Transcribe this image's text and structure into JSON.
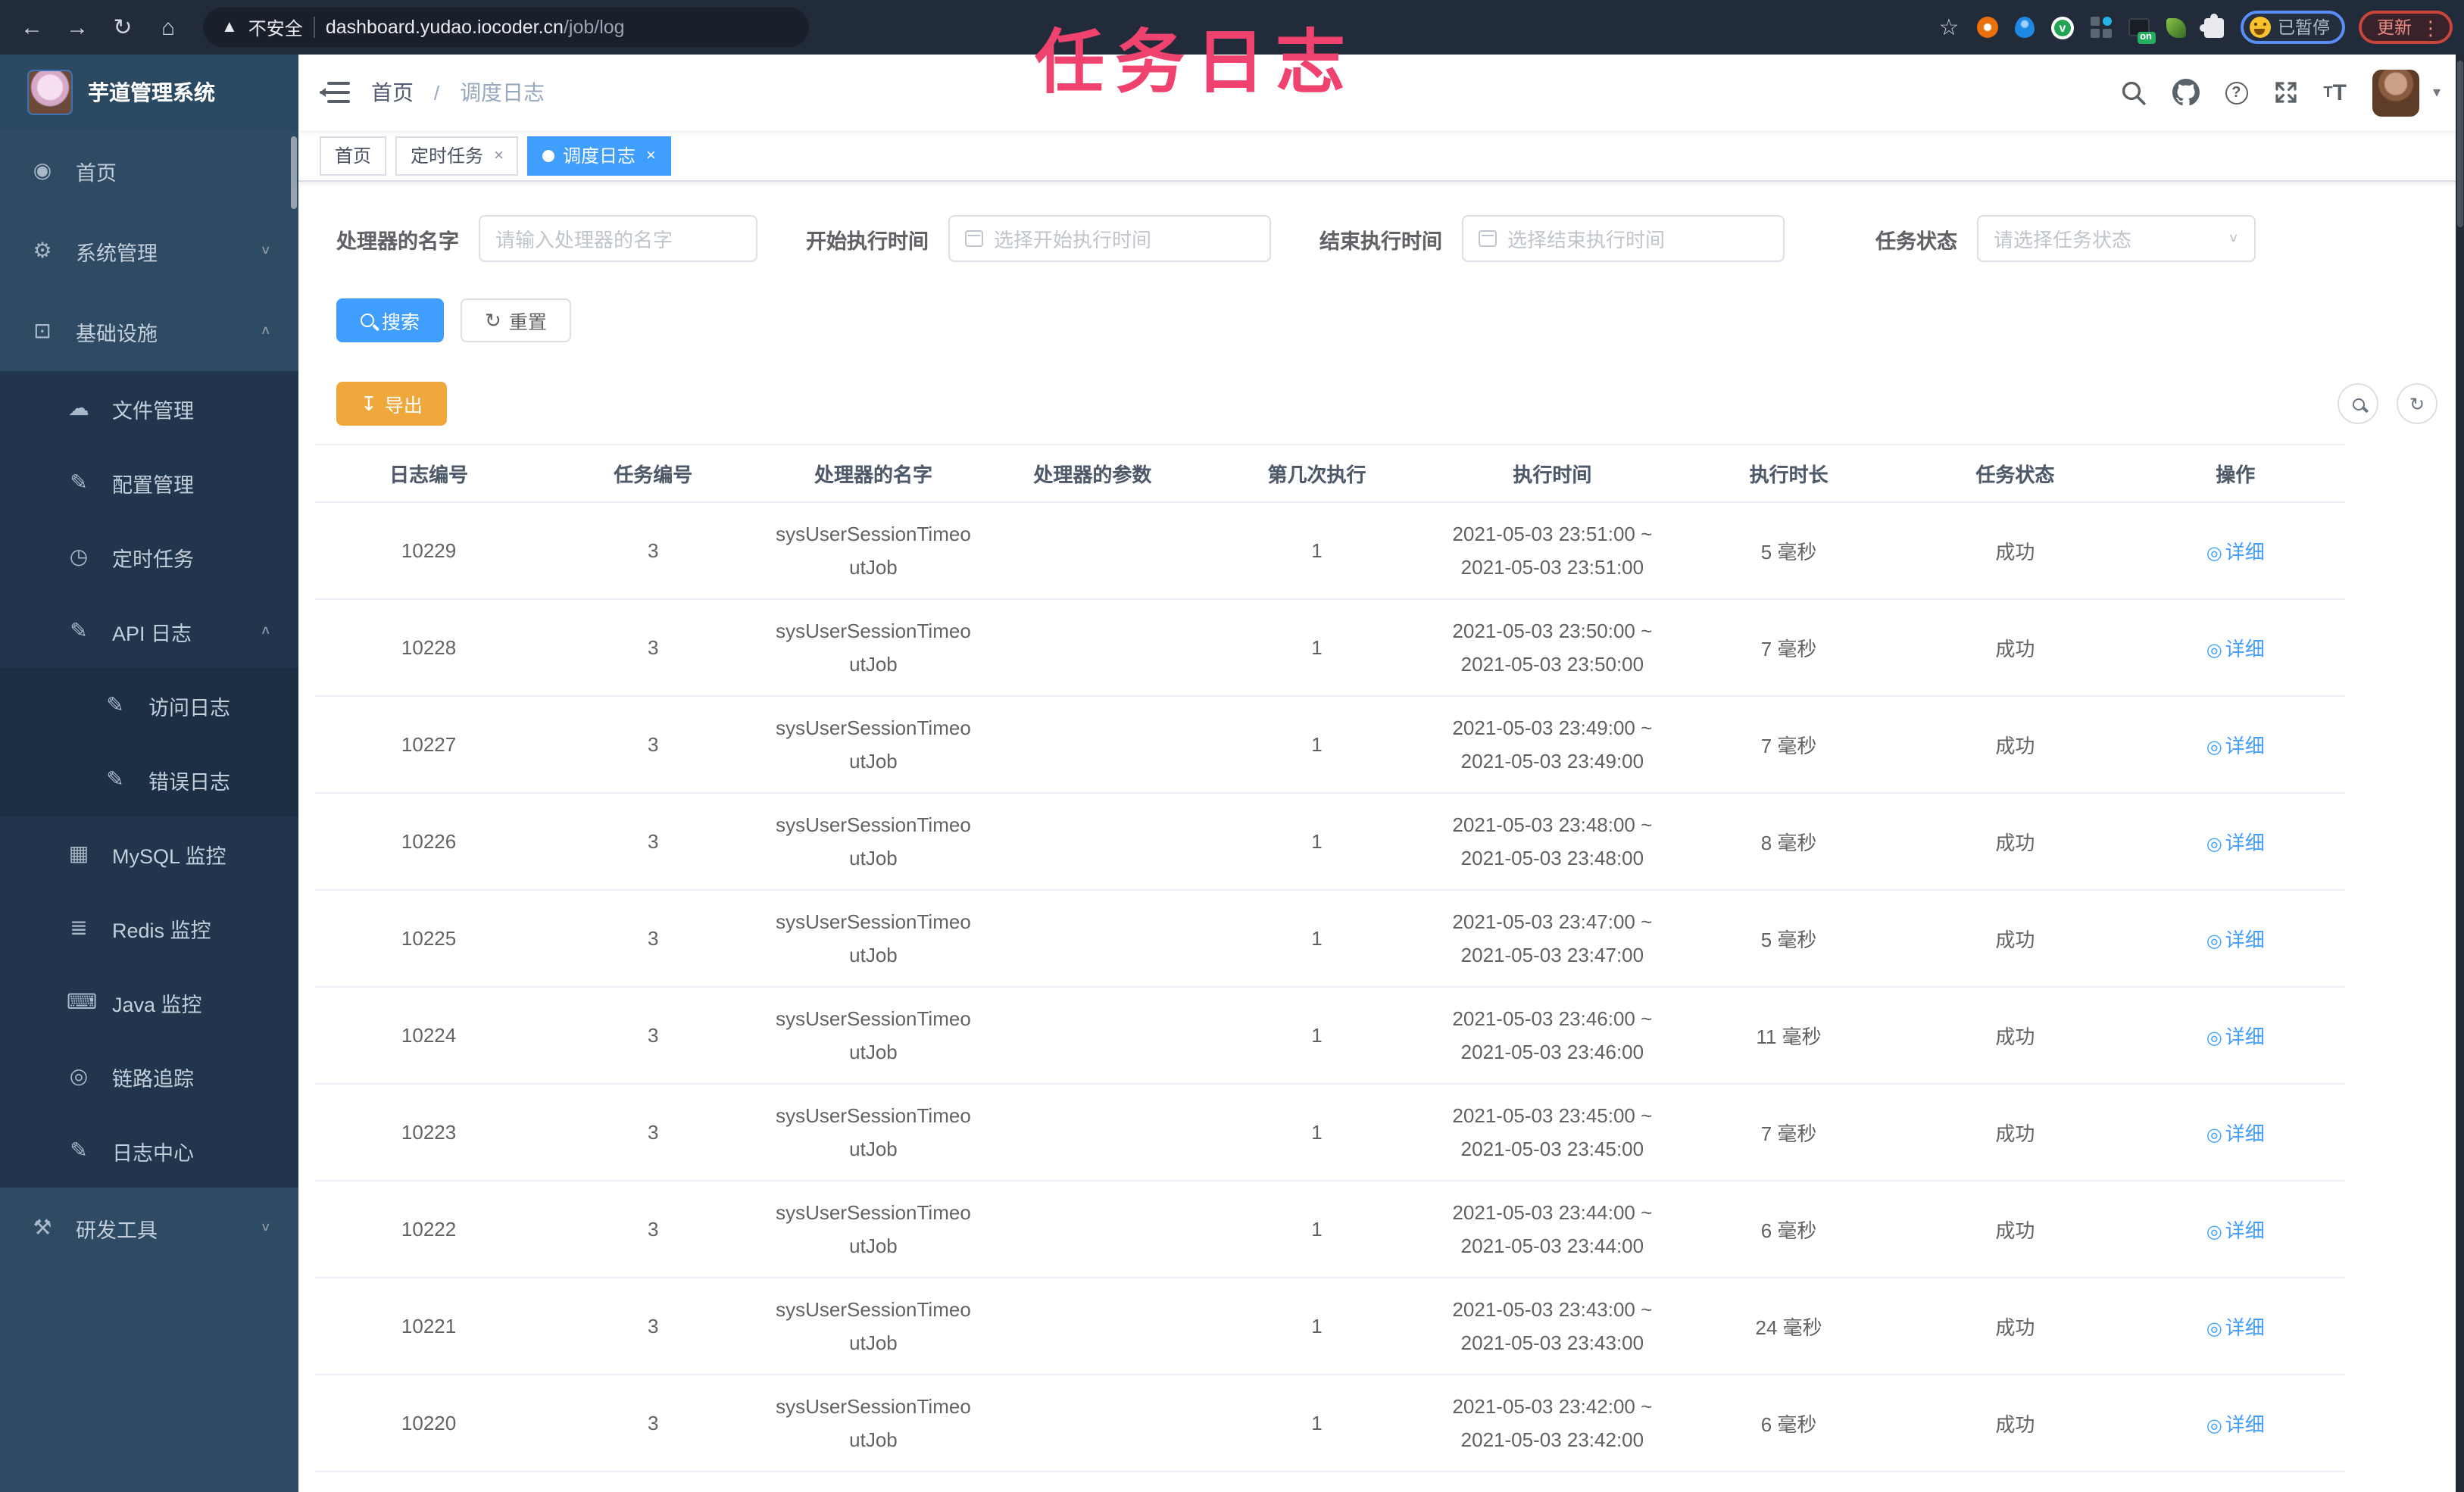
{
  "colors": {
    "accent": "#409eff",
    "warning": "#f0a73c",
    "overlay_pink": "#f0426e",
    "sidebar_bg": "#2e4b63",
    "sidebar_sub_bg": "#21354c"
  },
  "browser": {
    "security_label": "不安全",
    "url_host": "dashboard.yudao.iocoder.cn",
    "url_path": "/job/log",
    "extension_on_label": "on",
    "paused_badge": "已暂停",
    "update_label": "更新"
  },
  "overlay": {
    "title": "任务日志"
  },
  "sidebar": {
    "logo_title": "芋道管理系统",
    "items": [
      {
        "key": "home",
        "label": "首页",
        "icon": "dashboard-icon",
        "level": 1,
        "chevron": null
      },
      {
        "key": "system-mgmt",
        "label": "系统管理",
        "icon": "gear-icon",
        "level": 1,
        "chevron": "down"
      },
      {
        "key": "infrastructure",
        "label": "基础设施",
        "icon": "monitor-icon",
        "level": 1,
        "chevron": "up"
      },
      {
        "key": "file-mgmt",
        "label": "文件管理",
        "icon": "cloud-upload-icon",
        "level": 2,
        "chevron": null
      },
      {
        "key": "config-mgmt",
        "label": "配置管理",
        "icon": "edit-icon",
        "level": 2,
        "chevron": null
      },
      {
        "key": "scheduled-tasks",
        "label": "定时任务",
        "icon": "timer-icon",
        "level": 2,
        "chevron": null
      },
      {
        "key": "api-log",
        "label": "API 日志",
        "icon": "log-icon",
        "level": 2,
        "chevron": "up"
      },
      {
        "key": "access-log",
        "label": "访问日志",
        "icon": "log-icon",
        "level": 3,
        "chevron": null
      },
      {
        "key": "error-log",
        "label": "错误日志",
        "icon": "log-icon",
        "level": 3,
        "chevron": null
      },
      {
        "key": "mysql-monitor",
        "label": "MySQL 监控",
        "icon": "table-icon",
        "level": 2,
        "chevron": null
      },
      {
        "key": "redis-monitor",
        "label": "Redis 监控",
        "icon": "layers-icon",
        "level": 2,
        "chevron": null
      },
      {
        "key": "java-monitor",
        "label": "Java 监控",
        "icon": "java-icon",
        "level": 2,
        "chevron": null
      },
      {
        "key": "trace",
        "label": "链路追踪",
        "icon": "eye-icon",
        "level": 2,
        "chevron": null
      },
      {
        "key": "log-center",
        "label": "日志中心",
        "icon": "log-icon",
        "level": 2,
        "chevron": null
      },
      {
        "key": "dev-tools",
        "label": "研发工具",
        "icon": "toolbox-icon",
        "level": 1,
        "chevron": "down"
      }
    ]
  },
  "header": {
    "breadcrumb": [
      "首页",
      "调度日志"
    ]
  },
  "tags": [
    {
      "label": "首页",
      "closable": false,
      "active": false
    },
    {
      "label": "定时任务",
      "closable": true,
      "active": false
    },
    {
      "label": "调度日志",
      "closable": true,
      "active": true
    }
  ],
  "filters": [
    {
      "key": "handler-name",
      "label": "处理器的名字",
      "placeholder": "请输入处理器的名字",
      "type": "text"
    },
    {
      "key": "start-time",
      "label": "开始执行时间",
      "placeholder": "选择开始执行时间",
      "type": "date"
    },
    {
      "key": "end-time",
      "label": "结束执行时间",
      "placeholder": "选择结束执行时间",
      "type": "date"
    },
    {
      "key": "task-status",
      "label": "任务状态",
      "placeholder": "请选择任务状态",
      "type": "select"
    }
  ],
  "actions": {
    "search": "搜索",
    "reset": "重置",
    "export": "导出"
  },
  "table": {
    "columns": [
      "日志编号",
      "任务编号",
      "处理器的名字",
      "处理器的参数",
      "第几次执行",
      "执行时间",
      "执行时长",
      "任务状态",
      "操作"
    ],
    "detail_label": "详细",
    "rows": [
      {
        "log_id": "10229",
        "job_id": "3",
        "handler": "sysUserSessionTimeoutJob",
        "param": "",
        "exec_index": "1",
        "time": [
          "2021-05-03 23:51:00 ~",
          "2021-05-03 23:51:00"
        ],
        "duration": "5 毫秒",
        "status": "成功"
      },
      {
        "log_id": "10228",
        "job_id": "3",
        "handler": "sysUserSessionTimeoutJob",
        "param": "",
        "exec_index": "1",
        "time": [
          "2021-05-03 23:50:00 ~",
          "2021-05-03 23:50:00"
        ],
        "duration": "7 毫秒",
        "status": "成功"
      },
      {
        "log_id": "10227",
        "job_id": "3",
        "handler": "sysUserSessionTimeoutJob",
        "param": "",
        "exec_index": "1",
        "time": [
          "2021-05-03 23:49:00 ~",
          "2021-05-03 23:49:00"
        ],
        "duration": "7 毫秒",
        "status": "成功"
      },
      {
        "log_id": "10226",
        "job_id": "3",
        "handler": "sysUserSessionTimeoutJob",
        "param": "",
        "exec_index": "1",
        "time": [
          "2021-05-03 23:48:00 ~",
          "2021-05-03 23:48:00"
        ],
        "duration": "8 毫秒",
        "status": "成功"
      },
      {
        "log_id": "10225",
        "job_id": "3",
        "handler": "sysUserSessionTimeoutJob",
        "param": "",
        "exec_index": "1",
        "time": [
          "2021-05-03 23:47:00 ~",
          "2021-05-03 23:47:00"
        ],
        "duration": "5 毫秒",
        "status": "成功"
      },
      {
        "log_id": "10224",
        "job_id": "3",
        "handler": "sysUserSessionTimeoutJob",
        "param": "",
        "exec_index": "1",
        "time": [
          "2021-05-03 23:46:00 ~",
          "2021-05-03 23:46:00"
        ],
        "duration": "11 毫秒",
        "status": "成功"
      },
      {
        "log_id": "10223",
        "job_id": "3",
        "handler": "sysUserSessionTimeoutJob",
        "param": "",
        "exec_index": "1",
        "time": [
          "2021-05-03 23:45:00 ~",
          "2021-05-03 23:45:00"
        ],
        "duration": "7 毫秒",
        "status": "成功"
      },
      {
        "log_id": "10222",
        "job_id": "3",
        "handler": "sysUserSessionTimeoutJob",
        "param": "",
        "exec_index": "1",
        "time": [
          "2021-05-03 23:44:00 ~",
          "2021-05-03 23:44:00"
        ],
        "duration": "6 毫秒",
        "status": "成功"
      },
      {
        "log_id": "10221",
        "job_id": "3",
        "handler": "sysUserSessionTimeoutJob",
        "param": "",
        "exec_index": "1",
        "time": [
          "2021-05-03 23:43:00 ~",
          "2021-05-03 23:43:00"
        ],
        "duration": "24 毫秒",
        "status": "成功"
      },
      {
        "log_id": "10220",
        "job_id": "3",
        "handler": "sysUserSessionTimeoutJob",
        "param": "",
        "exec_index": "1",
        "time": [
          "2021-05-03 23:42:00 ~",
          "2021-05-03 23:42:00"
        ],
        "duration": "6 毫秒",
        "status": "成功"
      }
    ]
  }
}
